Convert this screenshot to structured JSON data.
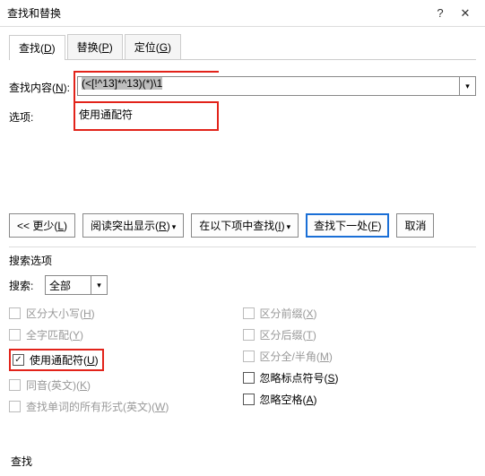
{
  "titlebar": {
    "title": "查找和替换",
    "help": "?",
    "close": "✕"
  },
  "tabs": {
    "find": {
      "label": "查找(",
      "accel": "D",
      "suffix": ")"
    },
    "replace": {
      "label": "替换(",
      "accel": "P",
      "suffix": ")"
    },
    "goto": {
      "label": "定位(",
      "accel": "G",
      "suffix": ")"
    }
  },
  "find": {
    "label": "查找内容(",
    "accel": "N",
    "suffix": "):",
    "value": "(<[!^13]*^13)(*)\\1",
    "options_label": "选项:",
    "options_value": "使用通配符"
  },
  "buttons": {
    "less": "<< 更少(",
    "less_accel": "L",
    "less_suffix": ")",
    "highlight": "阅读突出显示(",
    "highlight_accel": "R",
    "highlight_suffix": ")",
    "findin": "在以下项中查找(",
    "findin_accel": "I",
    "findin_suffix": ")",
    "findnext": "查找下一处(",
    "findnext_accel": "F",
    "findnext_suffix": ")",
    "cancel": "取消"
  },
  "searchopts": {
    "group": "搜索选项",
    "search_label": "搜索:",
    "search_value": "全部",
    "checks": {
      "case": {
        "label": "区分大小写(",
        "accel": "H",
        "suffix": ")"
      },
      "whole": {
        "label": "全字匹配(",
        "accel": "Y",
        "suffix": ")"
      },
      "wildcard": {
        "label": "使用通配符(",
        "accel": "U",
        "suffix": ")"
      },
      "sounds": {
        "label": "同音(英文)(",
        "accel": "K",
        "suffix": ")"
      },
      "forms": {
        "label": "查找单词的所有形式(英文)(",
        "accel": "W",
        "suffix": ")"
      },
      "prefix": {
        "label": "区分前缀(",
        "accel": "X",
        "suffix": ")"
      },
      "suffix": {
        "label": "区分后缀(",
        "accel": "T",
        "suffix": ")"
      },
      "fullhalf": {
        "label": "区分全/半角(",
        "accel": "M",
        "suffix": ")"
      },
      "punct": {
        "label": "忽略标点符号(",
        "accel": "S",
        "suffix": ")"
      },
      "space": {
        "label": "忽略空格(",
        "accel": "A",
        "suffix": ")"
      }
    }
  },
  "footer": {
    "label": "查找"
  }
}
